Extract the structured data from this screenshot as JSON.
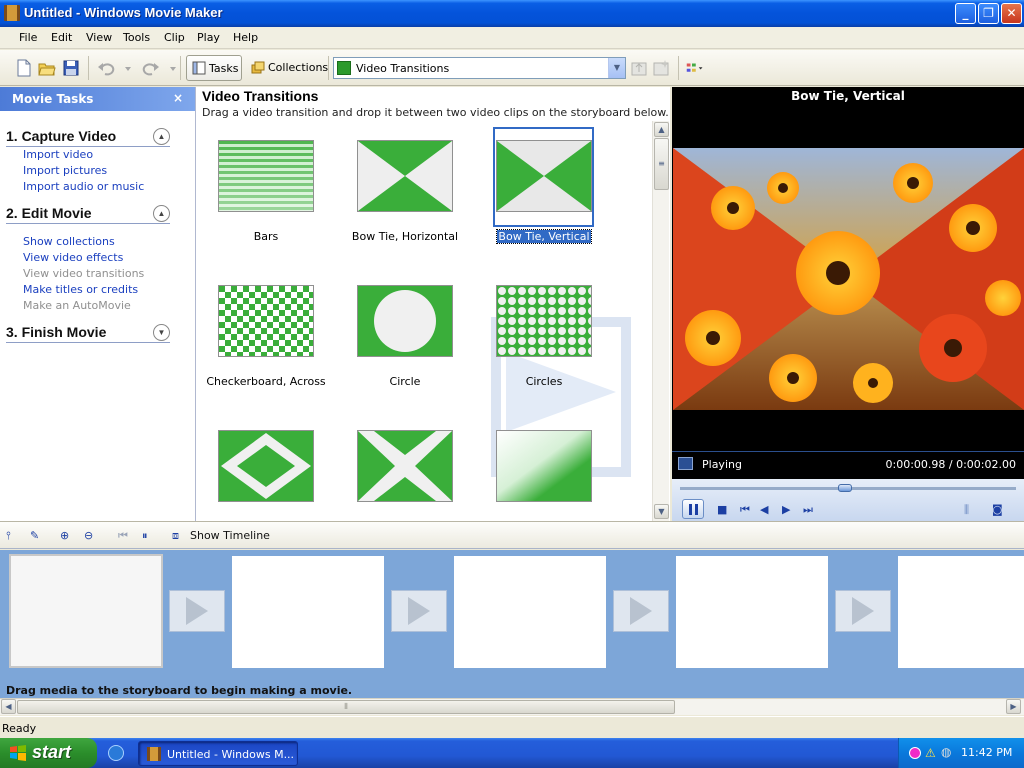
{
  "window": {
    "title": "Untitled - Windows Movie Maker"
  },
  "menu": [
    "File",
    "Edit",
    "View",
    "Tools",
    "Clip",
    "Play",
    "Help"
  ],
  "toolbar": {
    "tasks_label": "Tasks",
    "collections_label": "Collections",
    "collection_select": "Video Transitions"
  },
  "tasks_pane": {
    "title": "Movie Tasks",
    "close_glyph": "×",
    "sections": [
      {
        "title": "1. Capture Video",
        "expanded": true,
        "links": [
          {
            "label": "Import video",
            "enabled": true
          },
          {
            "label": "Import pictures",
            "enabled": true
          },
          {
            "label": "Import audio or music",
            "enabled": true
          }
        ]
      },
      {
        "title": "2. Edit Movie",
        "expanded": true,
        "links": [
          {
            "label": "Show collections",
            "enabled": true
          },
          {
            "label": "View video effects",
            "enabled": true
          },
          {
            "label": "View video transitions",
            "enabled": false
          },
          {
            "label": "Make titles or credits",
            "enabled": true
          },
          {
            "label": "Make an AutoMovie",
            "enabled": false
          }
        ]
      },
      {
        "title": "3. Finish Movie",
        "expanded": false,
        "links": []
      }
    ]
  },
  "content": {
    "title": "Video Transitions",
    "subtitle": "Drag a video transition and drop it between two video clips on the storyboard below.",
    "transitions": [
      {
        "name": "Bars",
        "icon": "bars-transition-icon",
        "selected": false
      },
      {
        "name": "Bow Tie, Horizontal",
        "icon": "bowtie-horizontal-icon",
        "selected": false
      },
      {
        "name": "Bow Tie, Vertical",
        "icon": "bowtie-vertical-icon",
        "selected": true
      },
      {
        "name": "Checkerboard, Across",
        "icon": "checkerboard-icon",
        "selected": false
      },
      {
        "name": "Circle",
        "icon": "circle-transition-icon",
        "selected": false
      },
      {
        "name": "Circles",
        "icon": "circles-transition-icon",
        "selected": false
      },
      {
        "name": "",
        "icon": "diamond-transition-icon",
        "selected": false
      },
      {
        "name": "",
        "icon": "diagonal-cross-transition-icon",
        "selected": false
      },
      {
        "name": "",
        "icon": "diagonal-fade-transition-icon",
        "selected": false
      }
    ]
  },
  "player": {
    "title": "Bow Tie, Vertical",
    "status": "Playing",
    "time": "0:00:00.98 / 0:00:02.00",
    "progress_fraction": 0.49
  },
  "storyboard_toolbar": {
    "show_timeline_label": "Show Timeline"
  },
  "storyboard": {
    "hint": "Drag media to the storyboard to begin making a movie.",
    "clip_slots": 5
  },
  "statusbar": {
    "text": "Ready"
  },
  "taskbar": {
    "start_label": "start",
    "app_button": "Untitled - Windows M...",
    "clock": "11:42 PM"
  },
  "colors": {
    "accent": "#316ac5",
    "transition_green": "#3aae3a",
    "storyboard_bg": "#7da6d8"
  }
}
